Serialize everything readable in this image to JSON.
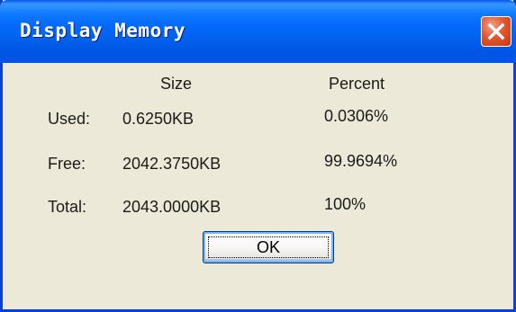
{
  "window": {
    "title": "Display Memory"
  },
  "table": {
    "headers": {
      "size": "Size",
      "percent": "Percent"
    },
    "rows": [
      {
        "label": "Used:",
        "size": "0.6250KB",
        "percent": "0.0306%"
      },
      {
        "label": "Free:",
        "size": "2042.3750KB",
        "percent": "99.9694%"
      },
      {
        "label": "Total:",
        "size": "2043.0000KB",
        "percent": "100%"
      }
    ]
  },
  "buttons": {
    "ok_label": "OK"
  },
  "icons": {
    "close": "close-icon"
  },
  "colors": {
    "titlebar": "#0054e3",
    "close_button": "#e0582e",
    "dialog_face": "#ece9d8"
  }
}
